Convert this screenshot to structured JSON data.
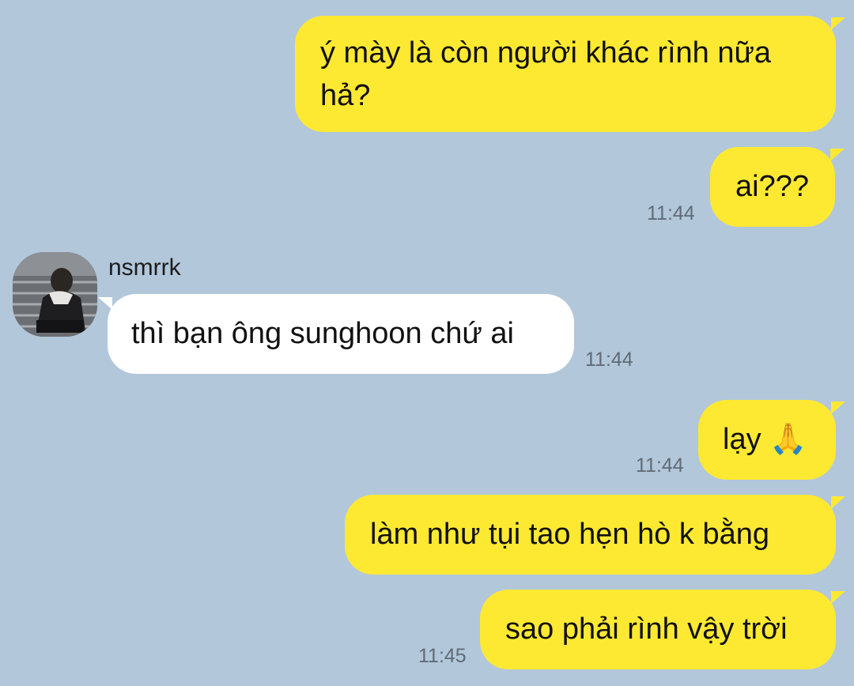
{
  "chat": {
    "messages": [
      {
        "text": "ý mày là còn người khác rình nữa hả?",
        "side": "me"
      },
      {
        "text": "ai???",
        "side": "me",
        "time": "11:44"
      },
      {
        "sender": "nsmrrk",
        "text": "thì bạn ông sunghoon chứ ai",
        "side": "them",
        "time": "11:44"
      },
      {
        "text": "lạy 🙏",
        "side": "me",
        "time": "11:44"
      },
      {
        "text": "làm như tụi tao hẹn hò k bằng",
        "side": "me"
      },
      {
        "text": "sao phải rình vậy trời",
        "side": "me",
        "time": "11:45"
      }
    ]
  },
  "colors": {
    "background": "#b2c7da",
    "outgoing_bubble": "#fee932",
    "incoming_bubble": "#ffffff",
    "timestamp": "#5f6b77"
  }
}
